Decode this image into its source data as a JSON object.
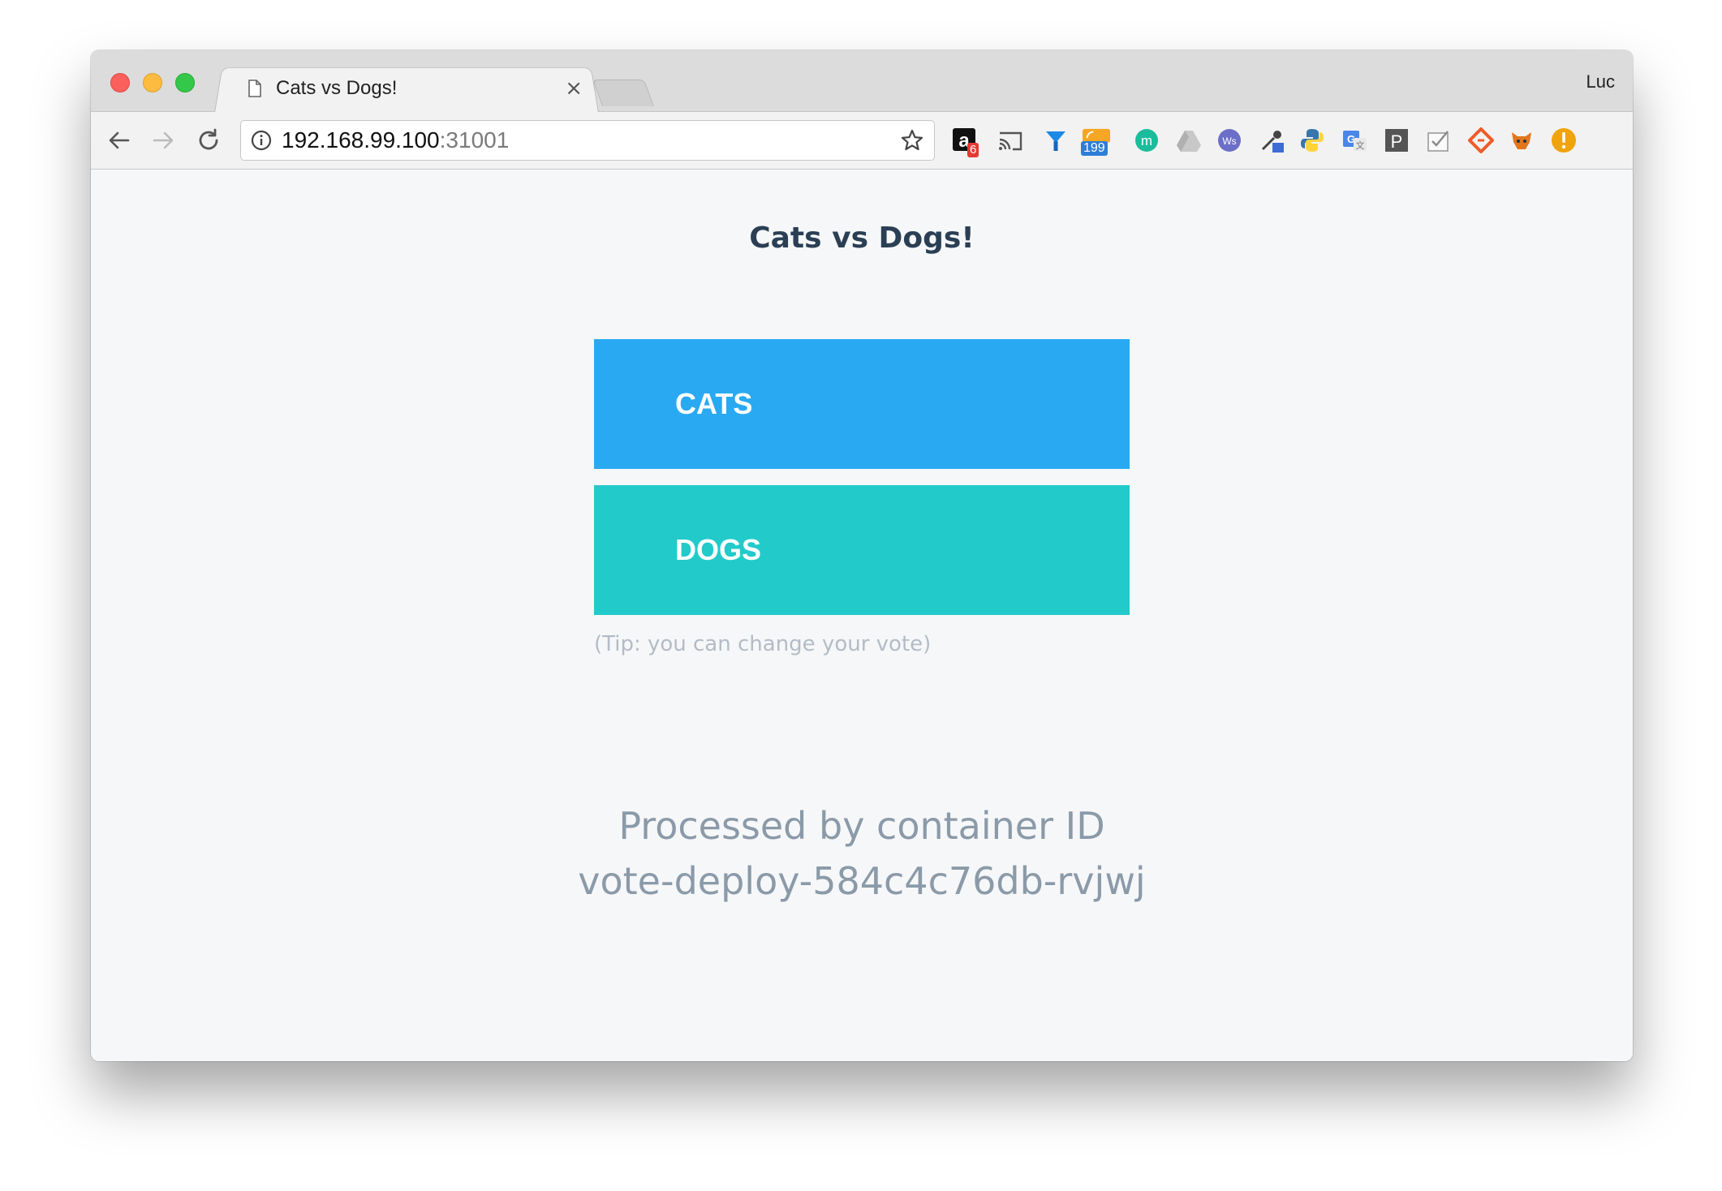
{
  "browser": {
    "tab_title": "Cats vs Dogs!",
    "tab_close": "×",
    "profile_name": "Luc",
    "url_host": "192.168.99.100",
    "url_port": ":31001",
    "extensions": [
      {
        "name": "amazon-icon",
        "badge": "6"
      },
      {
        "name": "cast-icon"
      },
      {
        "name": "extension-y-icon"
      },
      {
        "name": "rss-icon",
        "badge": "199"
      },
      {
        "name": "extension-m-icon"
      },
      {
        "name": "drive-icon"
      },
      {
        "name": "extension-ws-icon"
      },
      {
        "name": "eyedropper-icon"
      },
      {
        "name": "python-icon"
      },
      {
        "name": "translate-icon"
      },
      {
        "name": "extension-p-icon"
      },
      {
        "name": "checklist-icon"
      },
      {
        "name": "extension-diamond-icon"
      },
      {
        "name": "fox-icon"
      },
      {
        "name": "alert-icon"
      }
    ]
  },
  "page": {
    "title": "Cats vs Dogs!",
    "option_a": "CATS",
    "option_b": "DOGS",
    "tip": "(Tip: you can change your vote)",
    "processed_line1": "Processed by container ID",
    "processed_line2": "vote-deploy-584c4c76db-rvjwj"
  },
  "colors": {
    "cats_button": "#2aa9f3",
    "dogs_button": "#22caca",
    "title_text": "#2b3f54"
  }
}
